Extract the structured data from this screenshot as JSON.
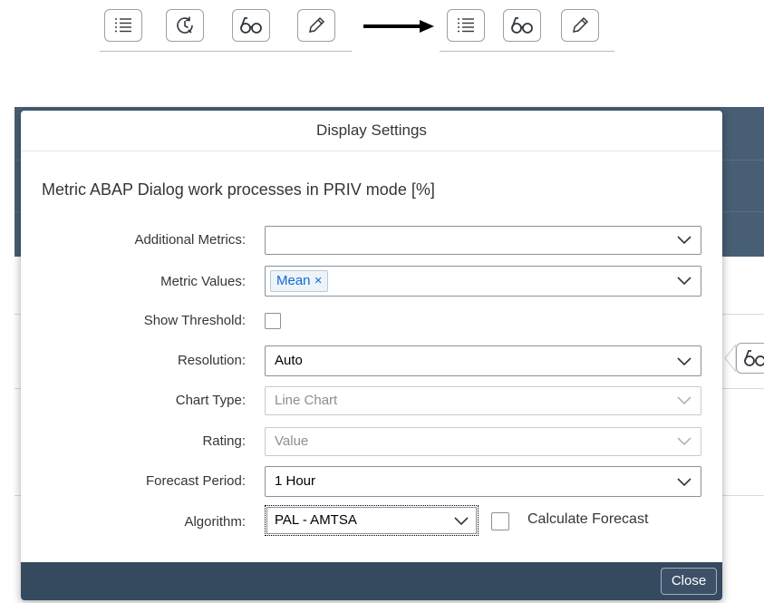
{
  "toolbar_before": {
    "buttons": [
      "list-icon",
      "history-icon",
      "glasses-icon",
      "pencil-icon"
    ]
  },
  "toolbar_after": {
    "buttons": [
      "list-icon",
      "glasses-icon",
      "pencil-icon"
    ]
  },
  "dialog": {
    "title": "Display Settings",
    "heading": "Metric ABAP Dialog work processes in PRIV mode [%]",
    "fields": {
      "additional_metrics": {
        "label": "Additional Metrics:",
        "value": ""
      },
      "metric_values": {
        "label": "Metric Values:",
        "token": "Mean",
        "token_remove": "×"
      },
      "show_threshold": {
        "label": "Show Threshold:",
        "checked": false
      },
      "resolution": {
        "label": "Resolution:",
        "value": "Auto"
      },
      "chart_type": {
        "label": "Chart Type:",
        "value": "Line Chart",
        "disabled": true
      },
      "rating": {
        "label": "Rating:",
        "value": "Value",
        "disabled": true
      },
      "forecast_period": {
        "label": "Forecast Period:",
        "value": "1 Hour"
      },
      "algorithm": {
        "label": "Algorithm:",
        "value": "PAL - AMTSA"
      },
      "calculate_forecast": {
        "label": "Calculate Forecast",
        "checked": false
      }
    },
    "close_label": "Close"
  },
  "colors": {
    "dialog_footer": "#354a5f",
    "background_header": "#475e75",
    "token_text": "#0a6ed1"
  }
}
